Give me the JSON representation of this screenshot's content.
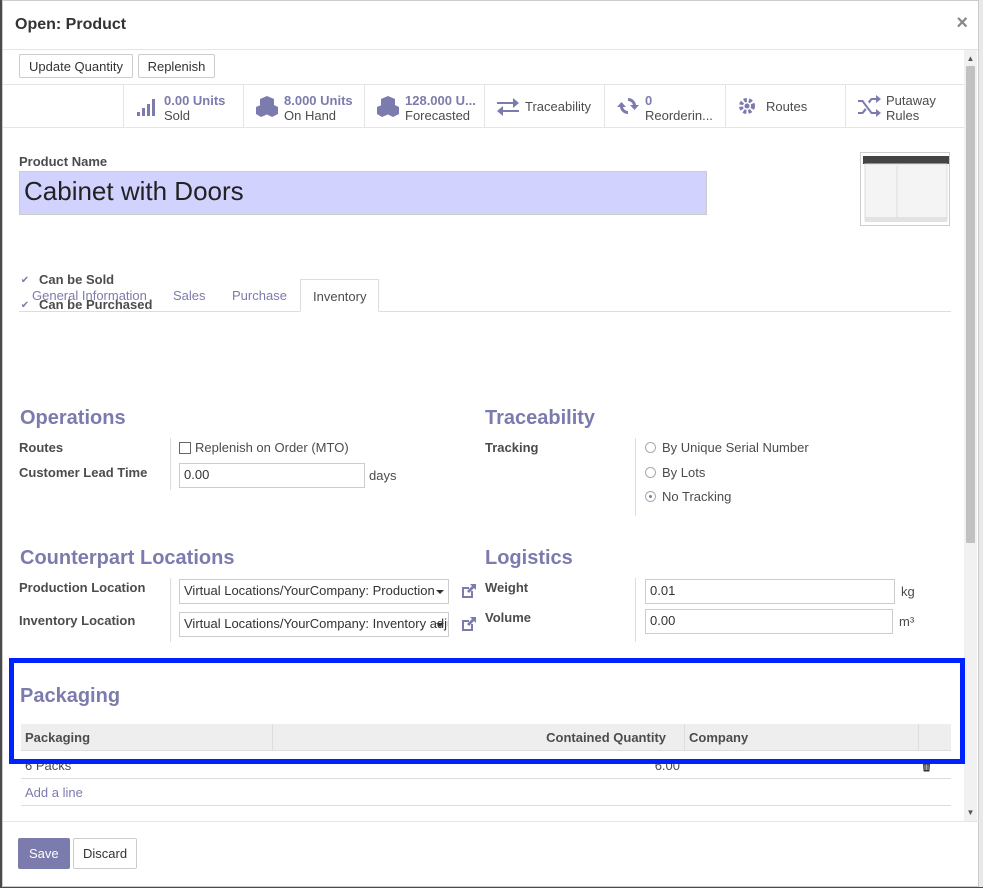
{
  "modal": {
    "title": "Open: Product",
    "close_glyph": "×"
  },
  "actions": {
    "update_quantity": "Update Quantity",
    "replenish": "Replenish"
  },
  "stat_buttons": [
    {
      "value": "0.00 Units",
      "label": "Sold",
      "icon": "bar-chart-icon"
    },
    {
      "value": "8.000 Units",
      "label": "On Hand",
      "icon": "cubes-icon"
    },
    {
      "value": "128.000 U...",
      "label": "Forecasted",
      "icon": "cubes-icon"
    },
    {
      "label": "Traceability",
      "icon": "arrows-exchange-icon"
    },
    {
      "value": "0",
      "label": "Reorderin...",
      "icon": "refresh-icon"
    },
    {
      "label": "Routes",
      "icon": "gears-icon"
    },
    {
      "label": "Putaway Rules",
      "label_line1": "Putaway",
      "label_line2": "Rules",
      "icon": "random-icon"
    }
  ],
  "product": {
    "name_label": "Product Name",
    "name": "Cabinet with Doors",
    "can_be_sold": "Can be Sold",
    "can_be_purchased": "Can be Purchased",
    "check_glyph": "✔"
  },
  "tabs": [
    {
      "label": "General Information"
    },
    {
      "label": "Sales"
    },
    {
      "label": "Purchase"
    },
    {
      "label": "Inventory",
      "active": true
    }
  ],
  "operations": {
    "title": "Operations",
    "routes_label": "Routes",
    "route_option": "Replenish on Order (MTO)",
    "lead_time_label": "Customer Lead Time",
    "lead_time_value": "0.00",
    "lead_time_unit": "days"
  },
  "traceability": {
    "title": "Traceability",
    "tracking_label": "Tracking",
    "options": [
      {
        "label": "By Unique Serial Number",
        "selected": false
      },
      {
        "label": "By Lots",
        "selected": false
      },
      {
        "label": "No Tracking",
        "selected": true
      }
    ]
  },
  "counterpart": {
    "title": "Counterpart Locations",
    "production_label": "Production Location",
    "production_value": "Virtual Locations/YourCompany: Production",
    "inventory_label": "Inventory Location",
    "inventory_value": "Virtual Locations/YourCompany: Inventory adjustment"
  },
  "logistics": {
    "title": "Logistics",
    "weight_label": "Weight",
    "weight_value": "0.01",
    "weight_unit": "kg",
    "volume_label": "Volume",
    "volume_value": "0.00",
    "volume_unit": "m³"
  },
  "packaging": {
    "title": "Packaging",
    "columns": [
      "Packaging",
      "Contained Quantity",
      "Company"
    ],
    "rows": [
      {
        "packaging": "6 Packs",
        "qty": "6.00",
        "company": ""
      }
    ],
    "add_line": "Add a line"
  },
  "footer": {
    "save": "Save",
    "discard": "Discard"
  },
  "colors": {
    "accent": "#7c7bad",
    "highlight": "#0022ff",
    "name_bg": "#d2d2ff"
  }
}
